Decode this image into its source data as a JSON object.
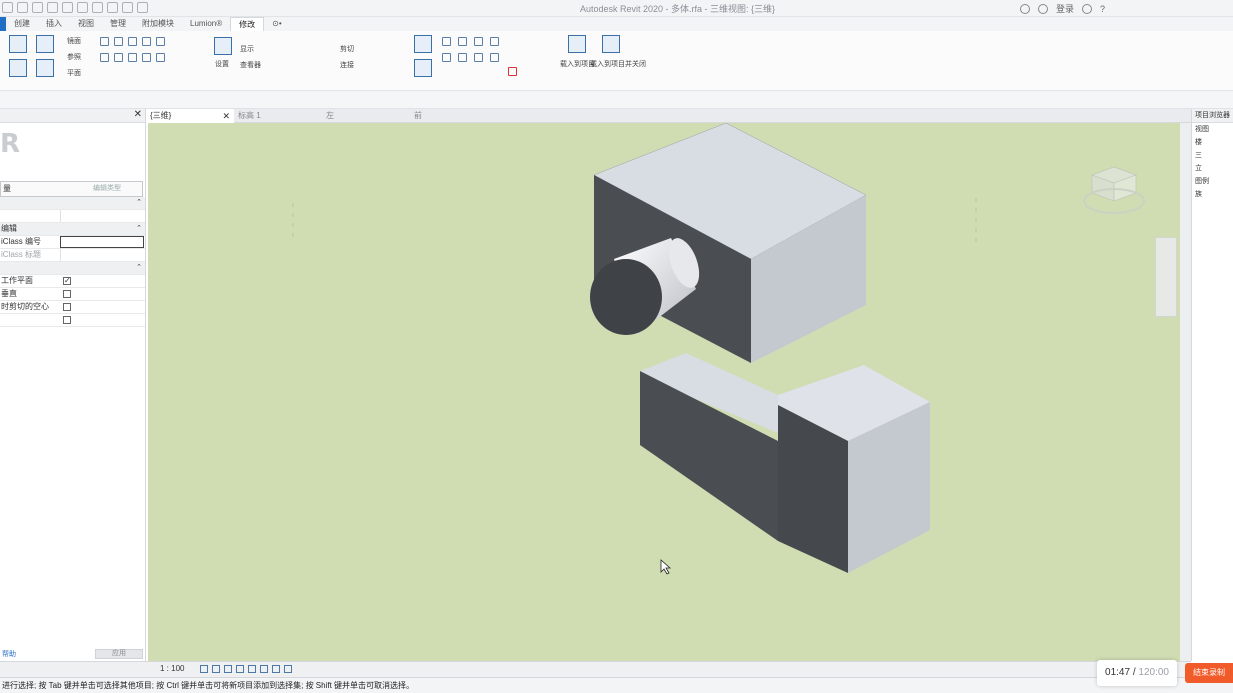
{
  "app": {
    "title": "Autodesk Revit 2020 - 多体.rfa - 三维视图: {三维}",
    "user": "登录",
    "help": "?"
  },
  "ribbon_tabs": [
    "创建",
    "插入",
    "视图",
    "管理",
    "附加模块",
    "Lumion®",
    "修改",
    "⊙•"
  ],
  "active_tab": "修改",
  "ribbon": {
    "labels": [
      "镜面",
      "参照",
      "平面",
      "显示",
      "查看器",
      "设置",
      "剪切",
      "连接",
      "载入到项目",
      "载入到项目并关闭"
    ]
  },
  "properties": {
    "type_selector": "量",
    "edit_type": "编辑类型",
    "rows": [
      {
        "label": "",
        "kind": "cat"
      },
      {
        "label": "",
        "kind": "blank"
      },
      {
        "label": "编辑",
        "kind": "cat"
      },
      {
        "label": "iClass 编号",
        "kind": "input"
      },
      {
        "label": "iClass 标题",
        "kind": "muted"
      },
      {
        "label": "",
        "kind": "cat"
      },
      {
        "label": "工作平面",
        "kind": "checkbox",
        "checked": true
      },
      {
        "label": "垂直",
        "kind": "checkbox",
        "checked": false
      },
      {
        "label": "时剪切的空心",
        "kind": "checkbox",
        "checked": false
      },
      {
        "label": "",
        "kind": "checkbox",
        "checked": false
      }
    ],
    "help_link": "帮助",
    "apply_button": "应用"
  },
  "view_tabs": [
    {
      "label": "{三维}",
      "active": true,
      "closable": true
    },
    {
      "label": "标高 1",
      "active": false,
      "closable": false
    },
    {
      "label": "左",
      "active": false,
      "closable": false
    },
    {
      "label": "前",
      "active": false,
      "closable": false
    }
  ],
  "browser": {
    "title": "项目浏览器",
    "items": [
      "视图",
      "楼",
      "三",
      "立",
      "图例",
      "族"
    ]
  },
  "view_control": {
    "scale": "1 : 100"
  },
  "status_bar": {
    "text": "进行选择; 按 Tab 键并单击可选择其他项目; 按 Ctrl 键并单击可将新项目添加到选择集; 按 Shift 键并单击可取消选择。"
  },
  "recorder": {
    "elapsed": "01:47",
    "total": "120:00",
    "button": "结束录制"
  },
  "colors": {
    "canvas_bg": "#d0dcb2",
    "face_top": "#d8dce3",
    "face_side": "#4a4d52",
    "face_front": "#c4c8cf",
    "accent": "#1f6fc4"
  }
}
